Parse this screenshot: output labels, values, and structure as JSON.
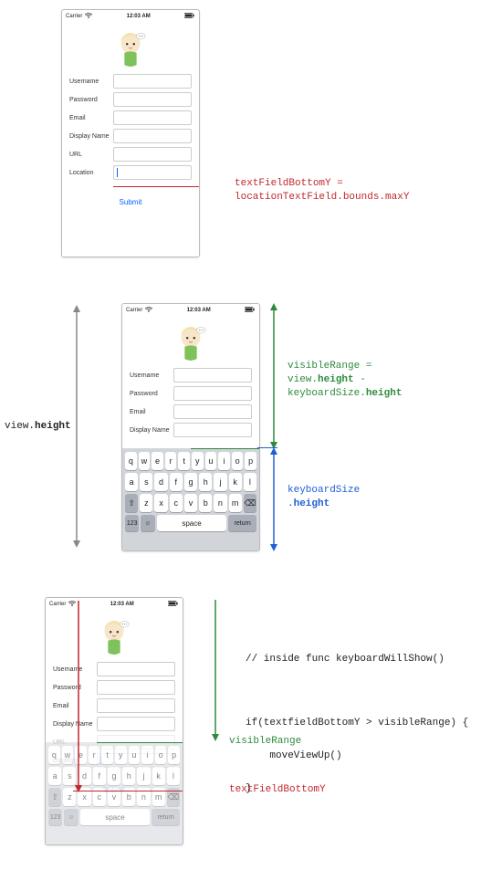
{
  "statusbar": {
    "carrier": "Carrier",
    "time": "12:03 AM",
    "wifi_icon": "wifi",
    "battery_icon": "battery"
  },
  "form": {
    "username": "Username",
    "password": "Password",
    "email": "Email",
    "display_name": "Display Name",
    "url": "URL",
    "location": "Location",
    "submit": "Submit"
  },
  "keyboard": {
    "row1": [
      "q",
      "w",
      "e",
      "r",
      "t",
      "y",
      "u",
      "i",
      "o",
      "p"
    ],
    "row2": [
      "a",
      "s",
      "d",
      "f",
      "g",
      "h",
      "j",
      "k",
      "l"
    ],
    "row3_shift": "⇧",
    "row3": [
      "z",
      "x",
      "c",
      "v",
      "b",
      "n",
      "m"
    ],
    "row3_del": "⌫",
    "row4_num": "123",
    "row4_emoji": "☺",
    "row4_space": "space",
    "row4_return": "return"
  },
  "annotations": {
    "p1_line1": "textFieldBottomY =",
    "p1_line2": "locationTextField.bounds.maxY",
    "p2_left": "view.height",
    "p2_right1": "visibleRange =",
    "p2_right2": "view.height -",
    "p2_right3": "keyboardSize.height",
    "p2_kb1": "keyboardSize",
    "p2_kb2": ".height",
    "p3_comment": "// inside func keyboardWillShow()",
    "p3_if": "if(textfieldBottomY > visibleRange) {",
    "p3_body": "    moveViewUp()",
    "p3_close": "}",
    "p3_vr": "visibleRange",
    "p3_tfb": "textFieldBottomY"
  }
}
